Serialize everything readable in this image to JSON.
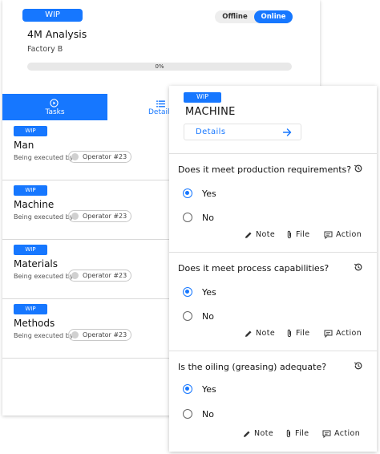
{
  "analysis": {
    "status_badge": "WIP",
    "connectivity": {
      "offline_label": "Offline",
      "online_label": "Online",
      "selected": "Online"
    },
    "title": "4M Analysis",
    "subtitle": "Factory B",
    "progress": {
      "value": 0,
      "label": "0%"
    },
    "tabs": [
      {
        "label": "Tasks",
        "icon": "play-circle-icon",
        "active": true
      },
      {
        "label": "Details",
        "icon": "list-icon",
        "active": false
      }
    ],
    "tasks": [
      {
        "badge": "WIP",
        "name": "Man",
        "exec_label": "Being executed by:",
        "operator": "Operator #23"
      },
      {
        "badge": "WIP",
        "name": "Machine",
        "exec_label": "Being executed by:",
        "operator": "Operator #23"
      },
      {
        "badge": "WIP",
        "name": "Materials",
        "exec_label": "Being executed by:",
        "operator": "Operator #23"
      },
      {
        "badge": "WIP",
        "name": "Methods",
        "exec_label": "Being executed by:",
        "operator": "Operator #23"
      }
    ]
  },
  "task_detail": {
    "status_badge": "WIP",
    "title": "MACHINE",
    "details_button": "Details",
    "questions": [
      {
        "text": "Does it meet production requirements?",
        "options": [
          {
            "label": "Yes",
            "checked": true
          },
          {
            "label": "No",
            "checked": false
          }
        ],
        "actions": {
          "note": "Note",
          "file": "File",
          "action": "Action"
        }
      },
      {
        "text": "Does it meet process capabilities?",
        "options": [
          {
            "label": "Yes",
            "checked": true
          },
          {
            "label": "No",
            "checked": false
          }
        ],
        "actions": {
          "note": "Note",
          "file": "File",
          "action": "Action"
        }
      },
      {
        "text": "Is the oiling (greasing) adequate?",
        "options": [
          {
            "label": "Yes",
            "checked": true
          },
          {
            "label": "No",
            "checked": false
          }
        ],
        "actions": {
          "note": "Note",
          "file": "File",
          "action": "Action"
        }
      }
    ]
  },
  "colors": {
    "accent": "#1677ff",
    "divider": "#d9d9d9",
    "track": "#e8e8e8"
  }
}
